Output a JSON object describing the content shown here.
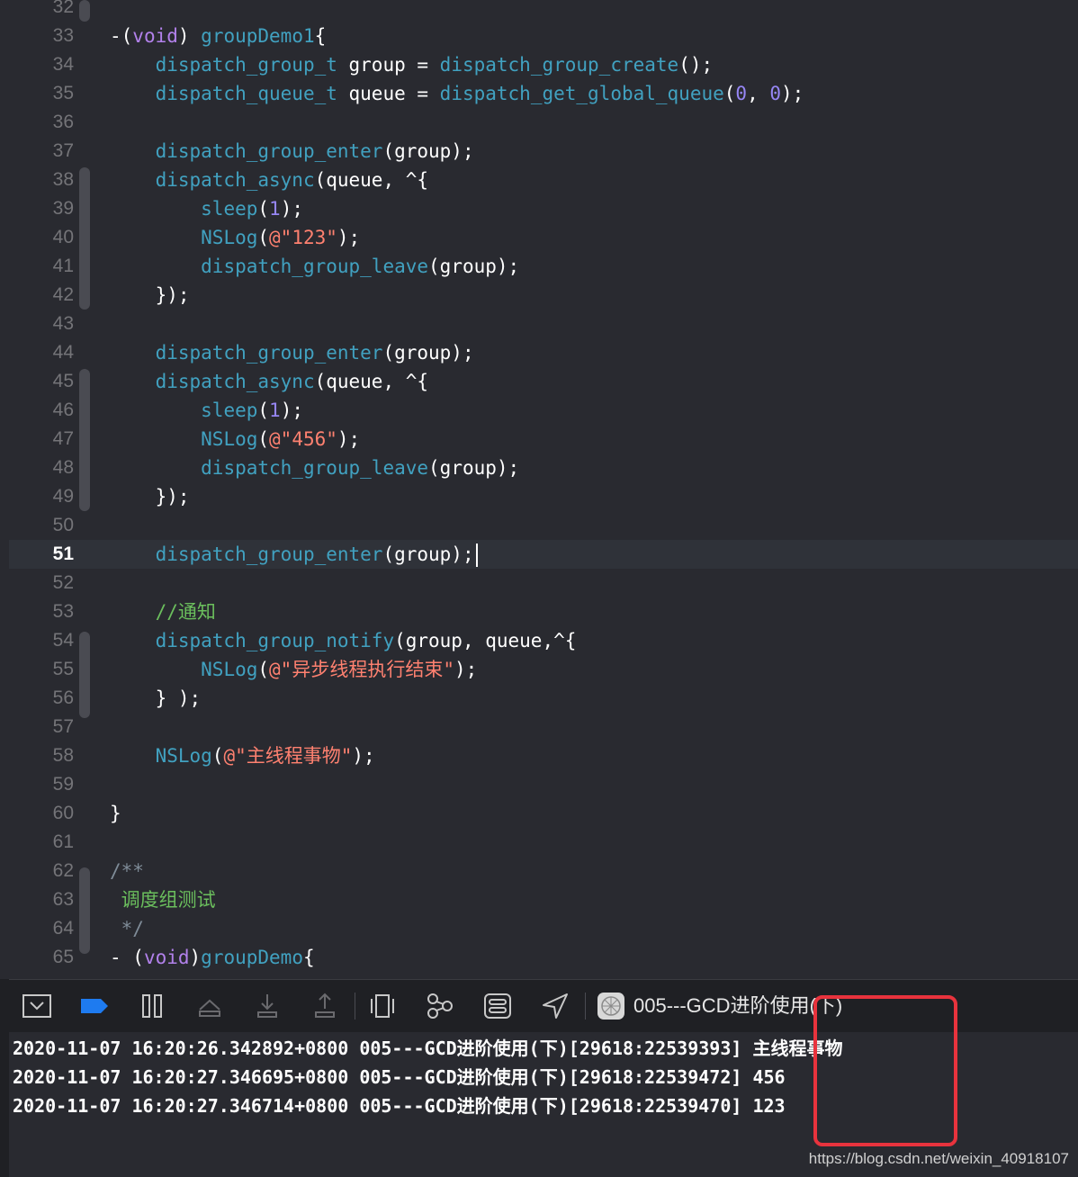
{
  "editor": {
    "current_line": "51",
    "lines": [
      {
        "n": "32",
        "tokens": []
      },
      {
        "n": "33",
        "tokens": [
          [
            "-(",
            "default"
          ],
          [
            "void",
            "kw"
          ],
          [
            ") ",
            "default"
          ],
          [
            "groupDemo1",
            "fn"
          ],
          [
            "{",
            "default"
          ]
        ]
      },
      {
        "n": "34",
        "tokens": [
          [
            "    ",
            "default"
          ],
          [
            "dispatch_group_t",
            "fn"
          ],
          [
            " group = ",
            "default"
          ],
          [
            "dispatch_group_create",
            "fn"
          ],
          [
            "();",
            "default"
          ]
        ]
      },
      {
        "n": "35",
        "tokens": [
          [
            "    ",
            "default"
          ],
          [
            "dispatch_queue_t",
            "fn"
          ],
          [
            " queue = ",
            "default"
          ],
          [
            "dispatch_get_global_queue",
            "fn"
          ],
          [
            "(",
            "default"
          ],
          [
            "0",
            "num2"
          ],
          [
            ", ",
            "default"
          ],
          [
            "0",
            "num2"
          ],
          [
            ");",
            "default"
          ]
        ]
      },
      {
        "n": "36",
        "tokens": []
      },
      {
        "n": "37",
        "tokens": [
          [
            "    ",
            "default"
          ],
          [
            "dispatch_group_enter",
            "fn"
          ],
          [
            "(group);",
            "default"
          ]
        ]
      },
      {
        "n": "38",
        "tokens": [
          [
            "    ",
            "default"
          ],
          [
            "dispatch_async",
            "fn"
          ],
          [
            "(queue, ^{",
            "default"
          ]
        ]
      },
      {
        "n": "39",
        "tokens": [
          [
            "        ",
            "default"
          ],
          [
            "sleep",
            "fn"
          ],
          [
            "(",
            "default"
          ],
          [
            "1",
            "num2"
          ],
          [
            ");",
            "default"
          ]
        ]
      },
      {
        "n": "40",
        "tokens": [
          [
            "        ",
            "default"
          ],
          [
            "NSLog",
            "fn"
          ],
          [
            "(",
            "default"
          ],
          [
            "@\"123\"",
            "str"
          ],
          [
            ");",
            "default"
          ]
        ]
      },
      {
        "n": "41",
        "tokens": [
          [
            "        ",
            "default"
          ],
          [
            "dispatch_group_leave",
            "fn"
          ],
          [
            "(group);",
            "default"
          ]
        ]
      },
      {
        "n": "42",
        "tokens": [
          [
            "    });",
            "default"
          ]
        ]
      },
      {
        "n": "43",
        "tokens": []
      },
      {
        "n": "44",
        "tokens": [
          [
            "    ",
            "default"
          ],
          [
            "dispatch_group_enter",
            "fn"
          ],
          [
            "(group);",
            "default"
          ]
        ]
      },
      {
        "n": "45",
        "tokens": [
          [
            "    ",
            "default"
          ],
          [
            "dispatch_async",
            "fn"
          ],
          [
            "(queue, ^{",
            "default"
          ]
        ]
      },
      {
        "n": "46",
        "tokens": [
          [
            "        ",
            "default"
          ],
          [
            "sleep",
            "fn"
          ],
          [
            "(",
            "default"
          ],
          [
            "1",
            "num2"
          ],
          [
            ");",
            "default"
          ]
        ]
      },
      {
        "n": "47",
        "tokens": [
          [
            "        ",
            "default"
          ],
          [
            "NSLog",
            "fn"
          ],
          [
            "(",
            "default"
          ],
          [
            "@\"456\"",
            "str"
          ],
          [
            ");",
            "default"
          ]
        ]
      },
      {
        "n": "48",
        "tokens": [
          [
            "        ",
            "default"
          ],
          [
            "dispatch_group_leave",
            "fn"
          ],
          [
            "(group);",
            "default"
          ]
        ]
      },
      {
        "n": "49",
        "tokens": [
          [
            "    });",
            "default"
          ]
        ]
      },
      {
        "n": "50",
        "tokens": []
      },
      {
        "n": "51",
        "tokens": [
          [
            "    ",
            "default"
          ],
          [
            "dispatch_group_enter",
            "fn"
          ],
          [
            "(group);",
            "default"
          ]
        ],
        "caret": true
      },
      {
        "n": "52",
        "tokens": []
      },
      {
        "n": "53",
        "tokens": [
          [
            "    ",
            "default"
          ],
          [
            "//通知",
            "cmt-cn"
          ]
        ]
      },
      {
        "n": "54",
        "tokens": [
          [
            "    ",
            "default"
          ],
          [
            "dispatch_group_notify",
            "fn"
          ],
          [
            "(group, queue,^{",
            "default"
          ]
        ]
      },
      {
        "n": "55",
        "tokens": [
          [
            "        ",
            "default"
          ],
          [
            "NSLog",
            "fn"
          ],
          [
            "(",
            "default"
          ],
          [
            "@\"异步线程执行结束\"",
            "str"
          ],
          [
            ");",
            "default"
          ]
        ]
      },
      {
        "n": "56",
        "tokens": [
          [
            "    } );",
            "default"
          ]
        ]
      },
      {
        "n": "57",
        "tokens": []
      },
      {
        "n": "58",
        "tokens": [
          [
            "    ",
            "default"
          ],
          [
            "NSLog",
            "fn"
          ],
          [
            "(",
            "default"
          ],
          [
            "@\"主线程事物\"",
            "str"
          ],
          [
            ");",
            "default"
          ]
        ]
      },
      {
        "n": "59",
        "tokens": []
      },
      {
        "n": "60",
        "tokens": [
          [
            "}",
            "default"
          ]
        ]
      },
      {
        "n": "61",
        "tokens": []
      },
      {
        "n": "62",
        "tokens": [
          [
            "/**",
            "cmt"
          ]
        ]
      },
      {
        "n": "63",
        "tokens": [
          [
            " 调度组测试",
            "cmt-cn"
          ]
        ]
      },
      {
        "n": "64",
        "tokens": [
          [
            " */",
            "cmt"
          ]
        ]
      },
      {
        "n": "65",
        "tokens": [
          [
            "- (",
            "default"
          ],
          [
            "void",
            "kw"
          ],
          [
            ")",
            "default"
          ],
          [
            "groupDemo",
            "fn"
          ],
          [
            "{",
            "default"
          ]
        ]
      }
    ]
  },
  "toolbar": {
    "icons": [
      "hide-console-icon",
      "breakpoints-icon",
      "pause-icon",
      "step-over-icon",
      "step-into-icon",
      "step-out-icon",
      "view-hierarchy-icon",
      "memory-graph-icon",
      "environment-overrides-icon",
      "location-icon",
      "app-icon"
    ],
    "scheme_label": "005---GCD进阶使用(下)"
  },
  "console": {
    "lines": [
      "2020-11-07 16:20:26.342892+0800 005---GCD进阶使用(下)[29618:22539393] 主线程事物",
      "2020-11-07 16:20:27.346695+0800 005---GCD进阶使用(下)[29618:22539472] 456",
      "2020-11-07 16:20:27.346714+0800 005---GCD进阶使用(下)[29618:22539470] 123"
    ]
  },
  "watermark": "https://blog.csdn.net/weixin_40918107",
  "colors": {
    "background": "#292a30",
    "function": "#41a1c0",
    "keyword": "#b281eb",
    "string": "#ff8170",
    "number": "#9686f5",
    "comment": "#7f8c98",
    "comment_cn": "#6bbf5d",
    "highlight_box": "#e8333d",
    "accent_blue": "#1e7bf0"
  }
}
